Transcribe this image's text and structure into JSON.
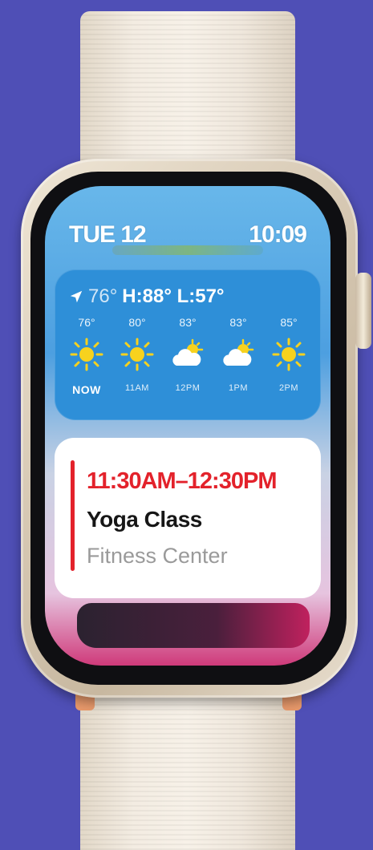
{
  "header": {
    "date": "TUE 12",
    "time": "10:09"
  },
  "weather": {
    "current_temp": "76°",
    "high_low": "H:88° L:57°",
    "forecast": [
      {
        "label": "NOW",
        "temp": "76°",
        "icon": "sun-icon"
      },
      {
        "label": "11AM",
        "temp": "80°",
        "icon": "sun-icon"
      },
      {
        "label": "12PM",
        "temp": "83°",
        "icon": "partly-cloudy-icon"
      },
      {
        "label": "1PM",
        "temp": "83°",
        "icon": "partly-cloudy-icon"
      },
      {
        "label": "2PM",
        "temp": "85°",
        "icon": "sun-icon"
      }
    ]
  },
  "event": {
    "time": "11:30AM–12:30PM",
    "title": "Yoga Class",
    "location": "Fitness Center"
  },
  "colors": {
    "background": "#4f4fb6",
    "weather_widget": "#2e8fd8",
    "event_accent": "#e3222b",
    "sun": "#f7d21e"
  }
}
